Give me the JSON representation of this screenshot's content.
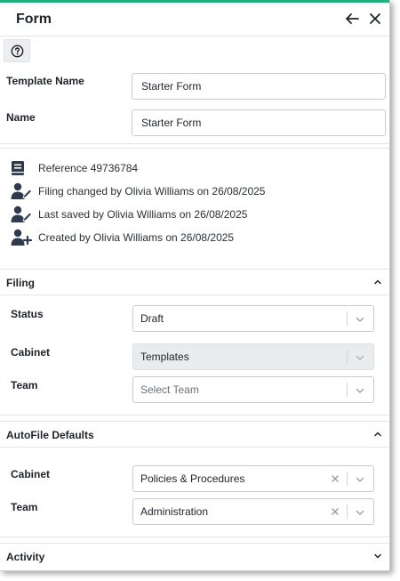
{
  "window": {
    "title": "Form"
  },
  "colors": {
    "accent": "#21b07d",
    "icon": "#2e3a4d"
  },
  "fields": {
    "template_name": {
      "label": "Template Name",
      "value": "Starter Form"
    },
    "name": {
      "label": "Name",
      "value": "Starter Form"
    }
  },
  "info": {
    "reference": "Reference 49736784",
    "filing_changed": "Filing changed by Olivia Williams on 26/08/2025",
    "last_saved": "Last saved by Olivia Williams on 26/08/2025",
    "created": "Created by Olivia Williams on 26/08/2025"
  },
  "filing": {
    "title": "Filing",
    "status": {
      "label": "Status",
      "value": "Draft"
    },
    "cabinet": {
      "label": "Cabinet",
      "value": "Templates"
    },
    "team": {
      "label": "Team",
      "placeholder": "Select Team"
    }
  },
  "autofile": {
    "title": "AutoFile Defaults",
    "cabinet": {
      "label": "Cabinet",
      "value": "Policies & Procedures"
    },
    "team": {
      "label": "Team",
      "value": "Administration"
    }
  },
  "activity": {
    "title": "Activity"
  }
}
